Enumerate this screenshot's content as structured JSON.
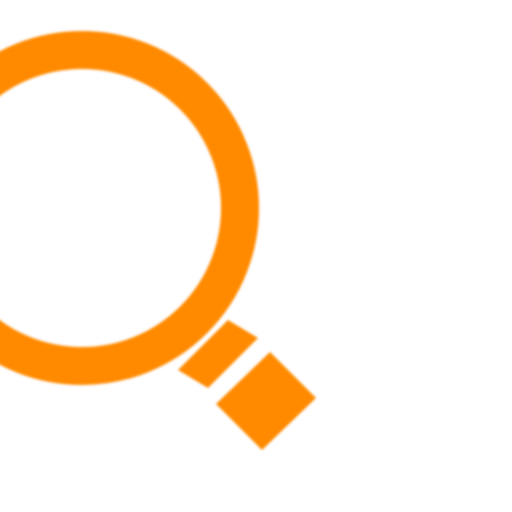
{
  "icon": {
    "name": "search-icon",
    "color": "#ff8a00"
  }
}
